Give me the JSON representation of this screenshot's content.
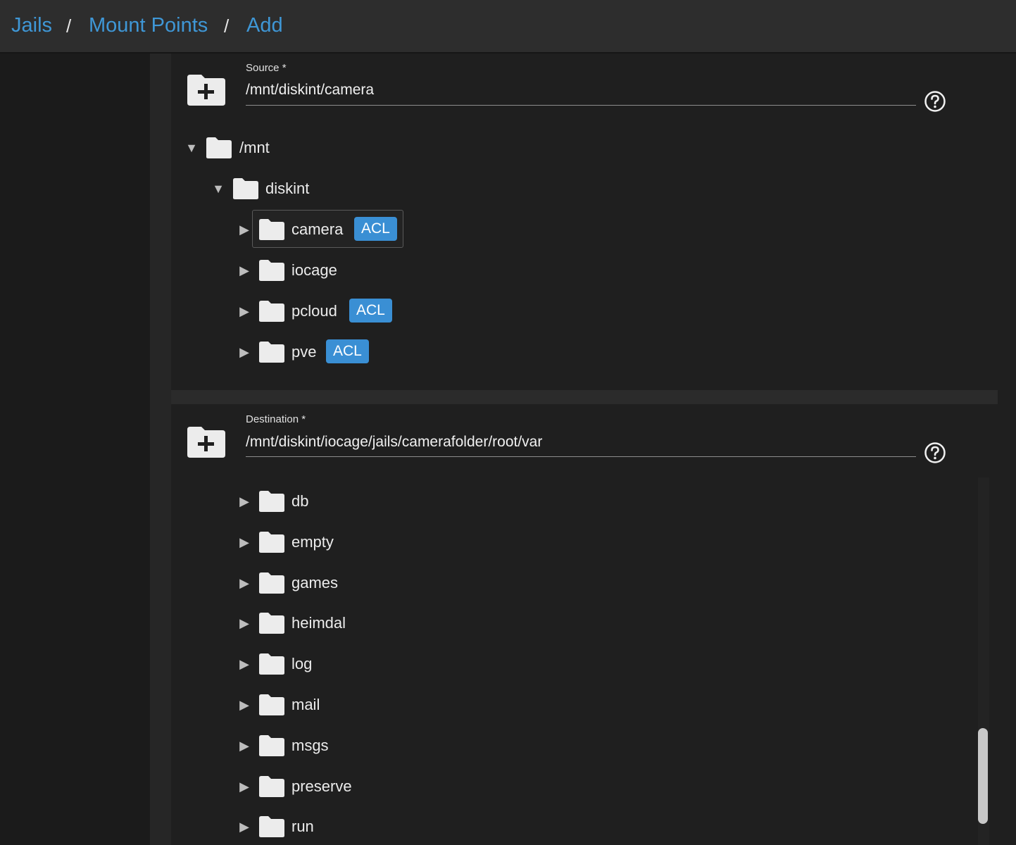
{
  "breadcrumb": {
    "items": [
      "Jails",
      "Mount Points",
      "Add"
    ],
    "separator": "/"
  },
  "source": {
    "label": "Source *",
    "value": "/mnt/diskint/camera",
    "tree": [
      {
        "name": "/mnt",
        "level": 0,
        "expanded": true,
        "acl": false
      },
      {
        "name": "diskint",
        "level": 1,
        "expanded": true,
        "acl": false
      },
      {
        "name": "camera",
        "level": 2,
        "expanded": false,
        "acl": true,
        "selected": true
      },
      {
        "name": "iocage",
        "level": 2,
        "expanded": false,
        "acl": false
      },
      {
        "name": "pcloud",
        "level": 2,
        "expanded": false,
        "acl": true
      },
      {
        "name": "pve",
        "level": 2,
        "expanded": false,
        "acl": true
      }
    ]
  },
  "destination": {
    "label": "Destination *",
    "value": "/mnt/diskint/iocage/jails/camerafolder/root/var",
    "tree": [
      {
        "name": "db"
      },
      {
        "name": "empty"
      },
      {
        "name": "games"
      },
      {
        "name": "heimdal"
      },
      {
        "name": "log"
      },
      {
        "name": "mail"
      },
      {
        "name": "msgs"
      },
      {
        "name": "preserve"
      },
      {
        "name": "run"
      }
    ]
  },
  "badge_label": "ACL",
  "icons": {
    "add_folder": "folder-plus-icon",
    "help": "help-circle-icon",
    "folder": "folder-icon",
    "expand": "triangle-right-icon",
    "collapse": "triangle-down-icon"
  },
  "colors": {
    "accent": "#3f97d6",
    "badge": "#3a8fd4",
    "background": "#1f1f1f",
    "topbar": "#2d2d2d"
  }
}
